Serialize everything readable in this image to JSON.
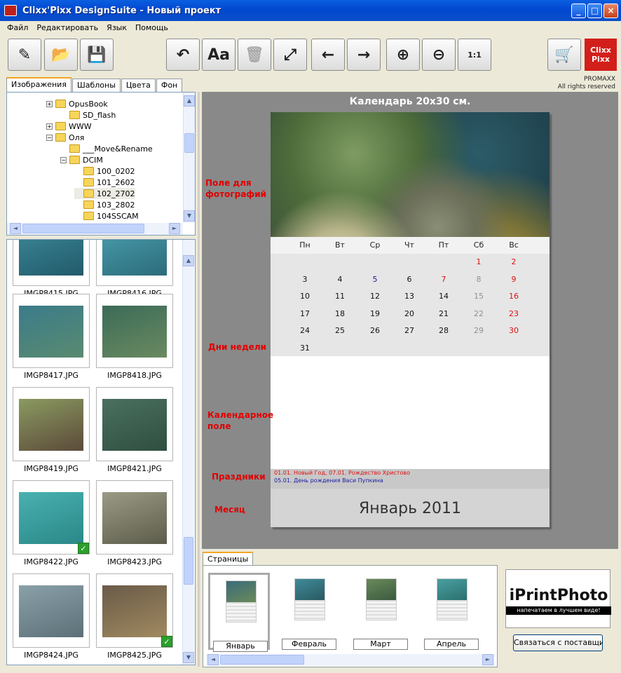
{
  "window": {
    "title": "Clixx'Pixx DesignSuite - Новый проект"
  },
  "menu": [
    "Файл",
    "Редактировать",
    "Язык",
    "Помощь"
  ],
  "toolbar": {
    "buttons": [
      {
        "icon": "edit-icon"
      },
      {
        "icon": "open-folder-icon"
      },
      {
        "icon": "save-icon"
      },
      {
        "icon": "undo-icon"
      },
      {
        "icon": "font-icon"
      },
      {
        "icon": "trash-icon"
      },
      {
        "icon": "fit-icon"
      },
      {
        "icon": "arrow-left-icon"
      },
      {
        "icon": "arrow-right-icon"
      },
      {
        "icon": "zoom-in-icon"
      },
      {
        "icon": "zoom-out-icon"
      },
      {
        "icon": "zoom-actual-icon"
      },
      {
        "icon": "cart-icon"
      }
    ],
    "zoom_actual_label": "1:1",
    "logo": {
      "line1": "Clixx",
      "line2": "Pixx"
    },
    "promaxx": "PROMAXX",
    "rights": "All rights reserved"
  },
  "left_tabs": [
    "Изображения",
    "Шаблоны",
    "Цвета",
    "Фон"
  ],
  "tree": [
    {
      "label": "OpusBook",
      "expand": "+"
    },
    {
      "label": "SD_flash",
      "expand": ""
    },
    {
      "label": "WWW",
      "expand": "+"
    },
    {
      "label": "Оля",
      "expand": "−"
    },
    {
      "label": "___Move&Rename",
      "expand": ""
    },
    {
      "label": "DCIM",
      "expand": "−"
    },
    {
      "label": "100_0202",
      "expand": ""
    },
    {
      "label": "101_2602",
      "expand": ""
    },
    {
      "label": "102_2702",
      "expand": ""
    },
    {
      "label": "103_2802",
      "expand": ""
    },
    {
      "label": "104SSCAM",
      "expand": ""
    }
  ],
  "thumbnails": [
    {
      "name": "IMGP8415.JPG",
      "checked": false
    },
    {
      "name": "IMGP8416.JPG",
      "checked": false
    },
    {
      "name": "IMGP8417.JPG",
      "checked": false
    },
    {
      "name": "IMGP8418.JPG",
      "checked": false
    },
    {
      "name": "IMGP8419.JPG",
      "checked": false
    },
    {
      "name": "IMGP8421.JPG",
      "checked": false
    },
    {
      "name": "IMGP8422.JPG",
      "checked": true
    },
    {
      "name": "IMGP8423.JPG",
      "checked": false
    },
    {
      "name": "IMGP8424.JPG",
      "checked": false
    },
    {
      "name": "IMGP8425.JPG",
      "checked": true
    }
  ],
  "calendar": {
    "title": "Календарь 20х30 см.",
    "weekdays": [
      "Пн",
      "Вт",
      "Ср",
      "Чт",
      "Пт",
      "Сб",
      "Вс"
    ],
    "days": [
      [
        "",
        "",
        "",
        "",
        "",
        "1",
        "2"
      ],
      [
        "3",
        "4",
        "5",
        "6",
        "7",
        "8",
        "9"
      ],
      [
        "10",
        "11",
        "12",
        "13",
        "14",
        "15",
        "16"
      ],
      [
        "17",
        "18",
        "19",
        "20",
        "21",
        "22",
        "23"
      ],
      [
        "24",
        "25",
        "26",
        "27",
        "28",
        "29",
        "30"
      ],
      [
        "31",
        "",
        "",
        "",
        "",
        "",
        ""
      ]
    ],
    "holidays": [
      "01.01. Новый Год, 07.01. Рождество Христово",
      "05.01. День рождения Васи Пупкина"
    ],
    "month": "Январь 2011",
    "colors": {
      "red": "#e01010",
      "blue": "#1a1aa0",
      "grey": "#909090"
    }
  },
  "annotations": {
    "photo": [
      "Поле для",
      "фотографий"
    ],
    "weekdays": "Дни недели",
    "grid": [
      "Календарное",
      "поле"
    ],
    "holidays": "Праздники",
    "month": "Месяц"
  },
  "pages_tab": "Страницы",
  "pages": [
    "Январь",
    "Февраль",
    "Март",
    "Апрель"
  ],
  "ad": {
    "title": "iPrintPhoto",
    "slogan": "напечатаем в лучшем виде!"
  },
  "contact_button": "Связаться с поставщиком"
}
